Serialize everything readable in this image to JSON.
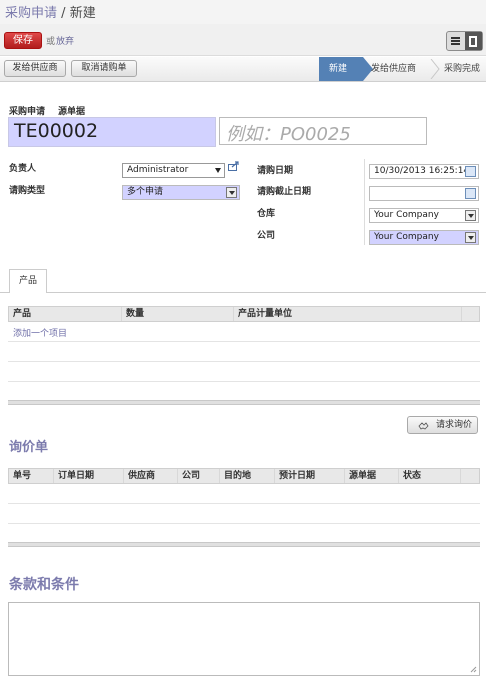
{
  "breadcrumb": {
    "parent": "采购申请",
    "separator": "/",
    "current": "新建"
  },
  "toolbar": {
    "save_label": "保存",
    "or_label": "或",
    "discard_label": "放弃"
  },
  "view_switcher": {
    "icons": [
      "list-view-icon",
      "form-view-icon"
    ],
    "active": "form-view-icon"
  },
  "actions": {
    "send_to_supplier": "发给供应商",
    "cancel_request": "取消请购单"
  },
  "stages": {
    "new": "新建",
    "sent": "发给供应商",
    "done": "采购完成",
    "current": "新建",
    "current_color": "#5481b5"
  },
  "form": {
    "name_label": "采购申请",
    "origin_label": "源单据",
    "name_value": "TE00002",
    "origin_placeholder": "例如：PO0025",
    "responsible_label": "负责人",
    "responsible_value": "Administrator",
    "type_label": "请购类型",
    "type_value": "多个申请",
    "date_label": "请购日期",
    "date_value": "10/30/2013 16:25:14",
    "deadline_label": "请购截止日期",
    "deadline_value": "",
    "warehouse_label": "仓库",
    "warehouse_value": "Your Company",
    "company_label": "公司",
    "company_value": "Your Company"
  },
  "product_tab": {
    "label": "产品",
    "columns": [
      "产品",
      "数量",
      "产品计量单位"
    ],
    "add_item_label": "添加一个项目"
  },
  "rfq": {
    "title": "询价单",
    "request_button": "请求询价",
    "columns": [
      "单号",
      "订单日期",
      "供应商",
      "公司",
      "目的地",
      "预计日期",
      "源单据",
      "状态"
    ]
  },
  "terms": {
    "title": "条款和条件",
    "value": ""
  },
  "colors": {
    "accent": "#7c7bad",
    "required_bg": "#d2d2ff",
    "save_red": "#c02a2a"
  }
}
